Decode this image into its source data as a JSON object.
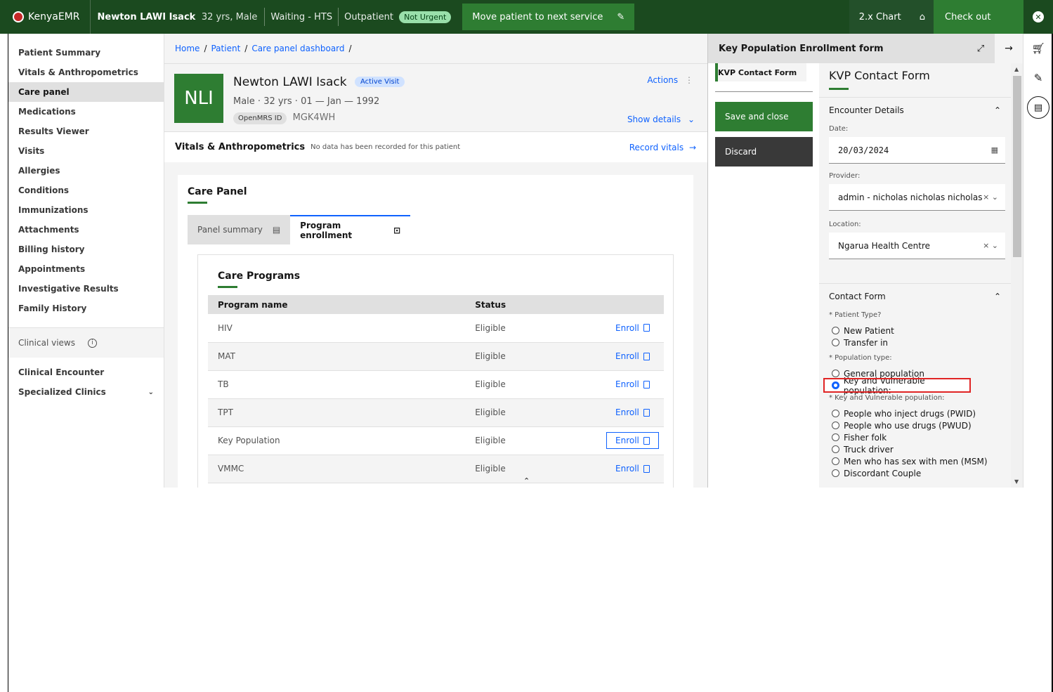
{
  "topbar": {
    "logo": "KenyaEMR",
    "patient_name": "Newton LAWI Isack",
    "patient_meta": "32 yrs, Male",
    "queue_status": "Waiting - HTS",
    "visit_type": "Outpatient",
    "priority": "Not Urgent",
    "move_label": "Move patient to next service",
    "chart_label": "2.x Chart",
    "checkout_label": "Check out"
  },
  "leftnav": {
    "items": [
      "Patient Summary",
      "Vitals & Anthropometrics",
      "Care panel",
      "Medications",
      "Results Viewer",
      "Visits",
      "Allergies",
      "Conditions",
      "Immunizations",
      "Attachments",
      "Billing history",
      "Appointments",
      "Investigative Results",
      "Family History"
    ],
    "active_index": 2,
    "clinical_views": "Clinical views",
    "bottom_items": [
      "Clinical Encounter",
      "Specialized Clinics"
    ]
  },
  "breadcrumb": [
    "Home",
    "Patient",
    "Care panel dashboard"
  ],
  "banner": {
    "initials": "NLI",
    "name": "Newton LAWI Isack",
    "visit_badge": "Active Visit",
    "demographics": "Male · 32 yrs · 01 — Jan — 1992",
    "id_label": "OpenMRS ID",
    "id_value": "MGK4WH",
    "actions": "Actions",
    "show_details": "Show details"
  },
  "vitals": {
    "title": "Vitals & Anthropometrics",
    "subtitle": "No data has been recorded for this patient",
    "record": "Record vitals"
  },
  "care_panel": {
    "title": "Care Panel",
    "tabs": [
      "Panel summary",
      "Program enrollment"
    ],
    "active_tab": 1,
    "programs_title": "Care Programs",
    "columns": [
      "Program name",
      "Status"
    ],
    "rows": [
      {
        "program": "HIV",
        "status": "Eligible",
        "action": "Enroll"
      },
      {
        "program": "MAT",
        "status": "Eligible",
        "action": "Enroll"
      },
      {
        "program": "TB",
        "status": "Eligible",
        "action": "Enroll"
      },
      {
        "program": "TPT",
        "status": "Eligible",
        "action": "Enroll"
      },
      {
        "program": "Key Population",
        "status": "Eligible",
        "action": "Enroll"
      },
      {
        "program": "VMMC",
        "status": "Eligible",
        "action": "Enroll"
      }
    ]
  },
  "form_panel": {
    "header": "Key Population Enrollment form",
    "nav_tab": "KVP Contact Form",
    "save": "Save and close",
    "discard": "Discard",
    "title": "KVP Contact Form",
    "encounter_section": "Encounter Details",
    "date_label": "Date:",
    "date_value": "20/03/2024",
    "provider_label": "Provider:",
    "provider_value": "admin - nicholas nicholas nicholas",
    "location_label": "Location:",
    "location_value": "Ngarua Health Centre",
    "contact_section": "Contact Form",
    "patient_type_label": "* Patient Type?",
    "patient_type_options": [
      "New Patient",
      "Transfer in"
    ],
    "population_type_label": "* Population type:",
    "population_type_options": [
      "General population",
      "Key and Vulnerable population:"
    ],
    "population_type_selected": 1,
    "kvp_label": "* Key and Vulnerable population:",
    "kvp_options": [
      "People who inject drugs (PWID)",
      "People who use drugs (PWUD)",
      "Fisher folk",
      "Truck driver",
      "Men who has sex with men (MSM)",
      "Discordant Couple"
    ]
  },
  "colors": {
    "brand_green": "#1b4a1f",
    "accent_green": "#2e7d32",
    "link_blue": "#0f62fe",
    "highlight_red": "#e02424"
  }
}
